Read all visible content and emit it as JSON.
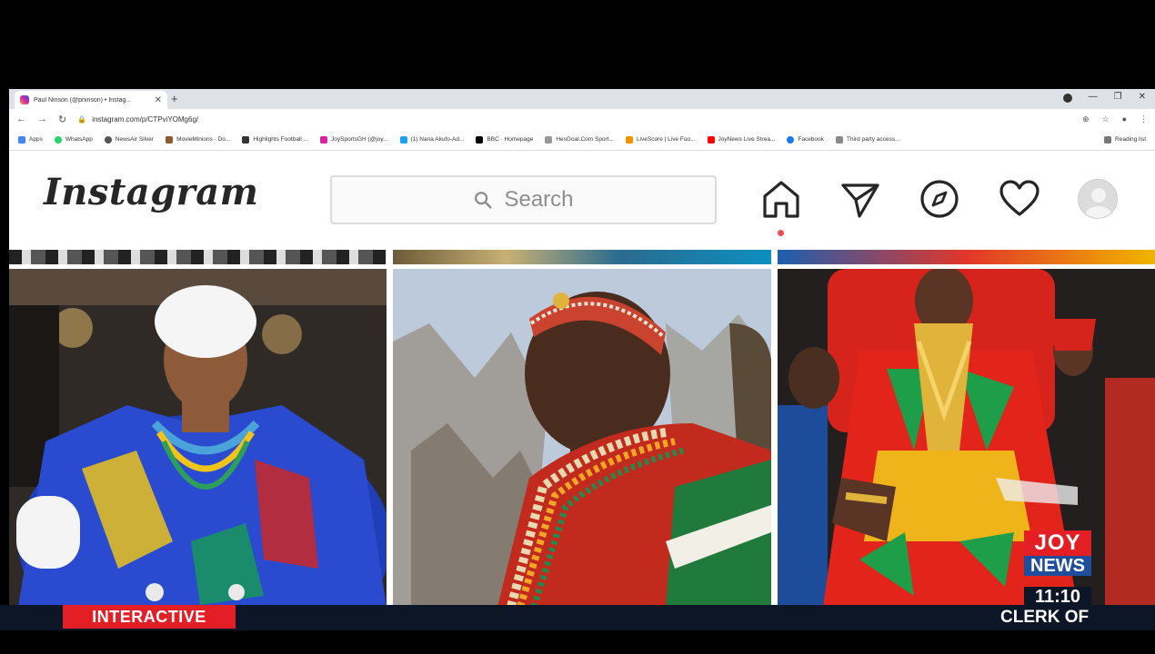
{
  "browser": {
    "tab_title": "Paul Ninson (@pninson) • Instag...",
    "new_tab": "+",
    "url": "instagram.com/p/CTPviYOMg6g/",
    "bookmarks": [
      "Apps",
      "WhatsApp",
      "NewsAir Silver",
      "MovieMinions · Do...",
      "Highlights Football ...",
      "JoySportsGH (@joy...",
      "(1) Nana Akufo-Ad...",
      "BBC · Homepage",
      "HesGoal.Com Sport...",
      "LiveScore | Live Foo...",
      "JoyNews Live Strea...",
      "Facebook",
      "Third party access..."
    ],
    "reading_list": "Reading list",
    "window_controls": [
      "",
      "—",
      "❐",
      "✕"
    ]
  },
  "instagram": {
    "logo": "Instagram",
    "search_placeholder": "Search",
    "nav_icons": [
      "home-icon",
      "direct-message-icon",
      "explore-icon",
      "activity-heart-icon",
      "profile-avatar"
    ]
  },
  "overlay": {
    "segment_label": "INTERACTIVE",
    "channel_joy": "JOY",
    "channel_news": "NEWS",
    "time": "11:10",
    "ticker": "CLERK OF"
  },
  "colors": {
    "segment_red": "#e31e24",
    "news_blue": "#1f4e9c",
    "ticker_bg": "#0c1626",
    "notification_dot": "#ed4956"
  }
}
